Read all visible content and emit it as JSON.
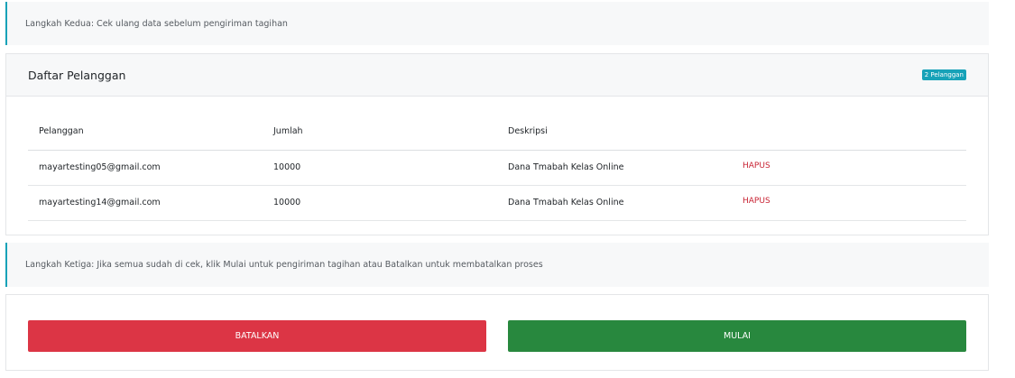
{
  "step2": {
    "text": "Langkah Kedua: Cek ulang data sebelum pengiriman tagihan"
  },
  "customer_list": {
    "title": "Daftar Pelanggan",
    "badge": "2 Pelanggan",
    "columns": [
      "Pelanggan",
      "Jumlah",
      "Deskripsi",
      ""
    ],
    "rows": [
      {
        "email": "mayartesting05@gmail.com",
        "amount": "10000",
        "description": "Dana Tmabah Kelas Online",
        "action": "HAPUS"
      },
      {
        "email": "mayartesting14@gmail.com",
        "amount": "10000",
        "description": "Dana Tmabah Kelas Online",
        "action": "HAPUS"
      }
    ]
  },
  "step3": {
    "text": "Langkah Ketiga: Jika semua sudah di cek, klik Mulai untuk pengiriman tagihan atau Batalkan untuk membatalkan proses"
  },
  "actions": {
    "cancel_label": "BATALKAN",
    "start_label": "MULAI"
  },
  "colors": {
    "accent": "#17a2b8",
    "danger": "#dc3545",
    "success": "#28883e",
    "delete_link": "#c82333"
  }
}
